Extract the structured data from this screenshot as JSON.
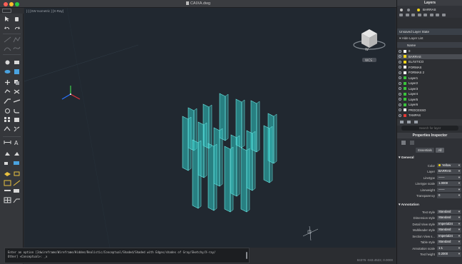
{
  "window": {
    "title": "CAIXA.dwg"
  },
  "viewport": {
    "label": "[-] [SW Isometric ] [X-Ray]",
    "viewcube_compass": "W",
    "wcs_badge": "WCS"
  },
  "command": {
    "line1": "Enter an option [2dwireframe/Wireframe/Hidden/Realistic/Conceptual/Shaded/Shaded with Edges/shades of Gray/Sketchy/X-ray/",
    "line2": "Other] <Conceptual>: _x"
  },
  "status": {
    "coords": "84376   -043.4522, 0.0000"
  },
  "layers": {
    "panel_title": "Layers",
    "current_layer": "BARRAS",
    "state_label": "Unsaved Layer State",
    "hide_list_label": "Hide Layer List",
    "header_name": "Name",
    "rows": [
      {
        "name": "0",
        "color": "#ffffff",
        "selected": false
      },
      {
        "name": "BARRAS",
        "color": "#f2d41a",
        "selected": true
      },
      {
        "name": "ELÁSTICO",
        "color": "#f2d41a",
        "selected": false
      },
      {
        "name": "FORMAS",
        "color": "#ffffff",
        "selected": false
      },
      {
        "name": "FORMAS 2",
        "color": "#ffffff",
        "selected": false
      },
      {
        "name": "Layer1",
        "color": "#39c43b",
        "selected": false
      },
      {
        "name": "Layer2",
        "color": "#39c43b",
        "selected": false
      },
      {
        "name": "Layer3",
        "color": "#39c43b",
        "selected": false
      },
      {
        "name": "Layer4",
        "color": "#39c43b",
        "selected": false
      },
      {
        "name": "Layer5",
        "color": "#39c43b",
        "selected": false
      },
      {
        "name": "Layer6",
        "color": "#39c43b",
        "selected": false
      },
      {
        "name": "PROCESSO",
        "color": "#ffffff",
        "selected": false
      },
      {
        "name": "TAMPAS",
        "color": "#e53935",
        "selected": false
      }
    ],
    "search_placeholder": "Search for layer"
  },
  "properties": {
    "panel_title": "Properties Inspector",
    "filter_label": "Essentials",
    "filter_all": "All",
    "general": {
      "title": "General",
      "rows": [
        {
          "label": "Color",
          "value": "Yellow",
          "swatch": true
        },
        {
          "label": "Layer",
          "value": "BARRAS"
        },
        {
          "label": "Linetype",
          "value": "——"
        },
        {
          "label": "Linetype scale",
          "value": "1.0000"
        },
        {
          "label": "Lineweight",
          "value": "——"
        },
        {
          "label": "Transparency",
          "value": "0"
        }
      ]
    },
    "annotation": {
      "title": "Annotation",
      "rows": [
        {
          "label": "Text style",
          "value": "Standard"
        },
        {
          "label": "Dimension style",
          "value": "Standard"
        },
        {
          "label": "Detail View style",
          "value": "Imperial24"
        },
        {
          "label": "Multileader style",
          "value": "Standard"
        },
        {
          "label": "Section View s...",
          "value": "Imperial24"
        },
        {
          "label": "Table style",
          "value": "Standard"
        },
        {
          "label": "Annotation scale",
          "value": "1:1"
        },
        {
          "label": "Text height",
          "value": "0.2000"
        }
      ]
    }
  },
  "colors": {
    "bars_fill": "#2fc6c4",
    "bars_edge": "#6ff0ec",
    "viewport_bg": "#212830"
  }
}
